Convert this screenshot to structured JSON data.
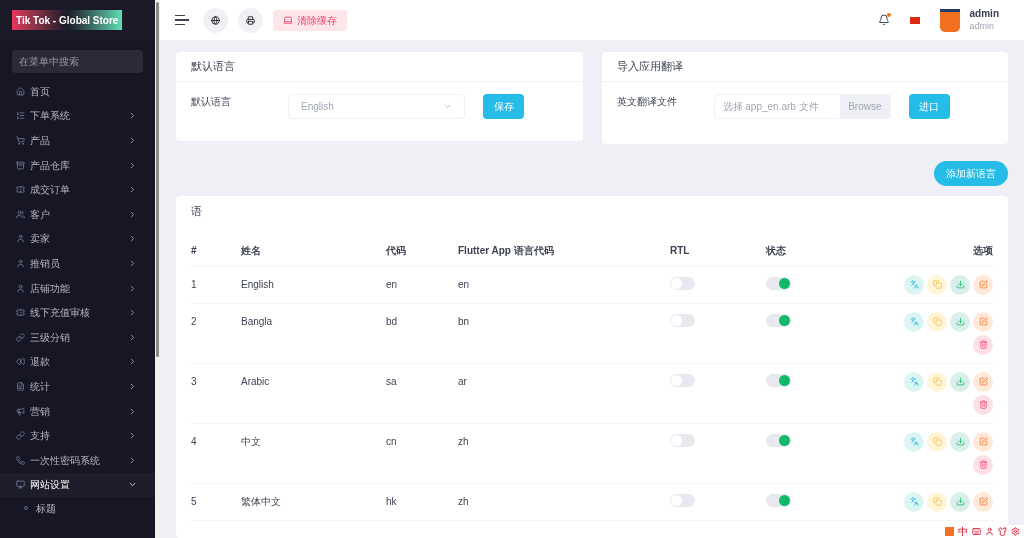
{
  "sidebar": {
    "logo_text": "Tik Tok - Global Store",
    "search": {
      "placeholder": "在菜单中搜索"
    },
    "items": [
      {
        "label": "首页",
        "has_arrow": false,
        "expanded": false,
        "selected": false
      },
      {
        "label": "下单系统",
        "has_arrow": true,
        "expanded": false,
        "selected": false
      },
      {
        "label": "产品",
        "has_arrow": true,
        "expanded": false,
        "selected": false
      },
      {
        "label": "产品仓库",
        "has_arrow": true,
        "expanded": false,
        "selected": false
      },
      {
        "label": "成交订单",
        "has_arrow": true,
        "expanded": false,
        "selected": false
      },
      {
        "label": "客户",
        "has_arrow": true,
        "expanded": false,
        "selected": false
      },
      {
        "label": "卖家",
        "has_arrow": true,
        "expanded": false,
        "selected": false
      },
      {
        "label": "推销员",
        "has_arrow": true,
        "expanded": false,
        "selected": false
      },
      {
        "label": "店铺功能",
        "has_arrow": true,
        "expanded": false,
        "selected": false
      },
      {
        "label": "线下充值审核",
        "has_arrow": true,
        "expanded": false,
        "selected": false
      },
      {
        "label": "三级分销",
        "has_arrow": true,
        "expanded": false,
        "selected": false
      },
      {
        "label": "退款",
        "has_arrow": true,
        "expanded": false,
        "selected": false
      },
      {
        "label": "统计",
        "has_arrow": true,
        "expanded": false,
        "selected": false
      },
      {
        "label": "营销",
        "has_arrow": true,
        "expanded": false,
        "selected": false
      },
      {
        "label": "支持",
        "has_arrow": true,
        "expanded": false,
        "selected": false
      },
      {
        "label": "一次性密码系统",
        "has_arrow": true,
        "expanded": false,
        "selected": false
      },
      {
        "label": "网站设置",
        "has_arrow": true,
        "expanded": true,
        "selected": true,
        "children": [
          {
            "label": "标题"
          }
        ]
      }
    ]
  },
  "topbar": {
    "clear_cache": "清除缓存",
    "notification_dot": true,
    "user": {
      "name": "admin",
      "role": "admin"
    }
  },
  "default_language": {
    "title": "默认语言",
    "label": "默认语言",
    "value": "English",
    "button": "保存"
  },
  "import": {
    "title": "导入应用翻译",
    "label": "英文翻译文件",
    "placeholder": "选择 app_en.arb 文件",
    "browse": "Browse",
    "button": "进口"
  },
  "add_button": "添加新语言",
  "table": {
    "title": "语",
    "columns": [
      "#",
      "姓名",
      "代码",
      "Flutter App 语言代码",
      "RTL",
      "状态",
      "选项"
    ],
    "rows": [
      {
        "num": "1",
        "name": "English",
        "code": "en",
        "app_code": "en",
        "rtl": false,
        "status": true,
        "deletable": false
      },
      {
        "num": "2",
        "name": "Bangla",
        "code": "bd",
        "app_code": "bn",
        "rtl": false,
        "status": true,
        "deletable": true
      },
      {
        "num": "3",
        "name": "Arabic",
        "code": "sa",
        "app_code": "ar",
        "rtl": false,
        "status": true,
        "deletable": true
      },
      {
        "num": "4",
        "name": "中文",
        "code": "cn",
        "app_code": "zh",
        "rtl": false,
        "status": true,
        "deletable": true
      },
      {
        "num": "5",
        "name": "繁体中文",
        "code": "hk",
        "app_code": "zh",
        "rtl": false,
        "status": true,
        "deletable": false
      }
    ]
  },
  "ime_bar": {
    "mode": "中"
  }
}
